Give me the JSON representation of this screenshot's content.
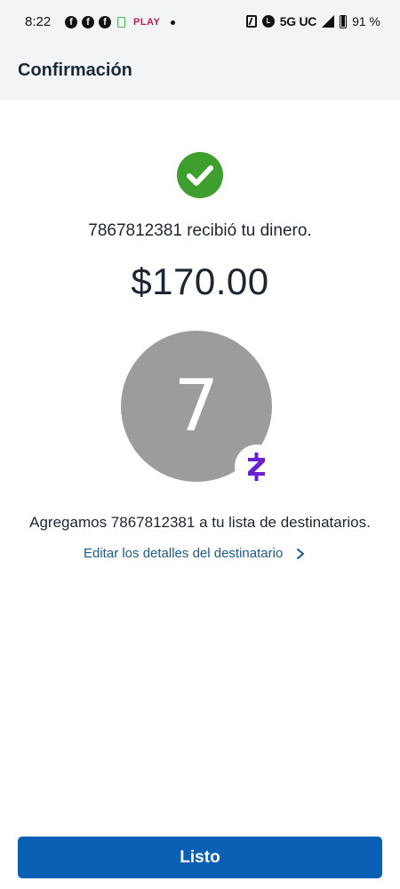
{
  "status_bar": {
    "time": "8:22",
    "left_icons": [
      "facebook-icon",
      "facebook-icon",
      "facebook-icon",
      "message-icon",
      "play-badge-icon",
      "dot-icon"
    ],
    "play_badge_top": "",
    "play_badge_text": "PLAY",
    "network": "5G UC",
    "battery_percent": 0.91,
    "battery_text": "91 %"
  },
  "app_bar": {
    "title": "Confirmación"
  },
  "main": {
    "status_icon": "check-circle-icon",
    "received_text": "7867812381 recibió tu dinero.",
    "amount": "$170.00",
    "recipient": {
      "initial": "7",
      "badge_icon": "zelle-logo-icon"
    },
    "added_text": "Agregamos 7867812381 a tu lista de destinatarios.",
    "edit_link_label": "Editar los detalles del destinatario",
    "edit_link_icon": "chevron-right-icon"
  },
  "footer": {
    "done_label": "Listo"
  },
  "colors": {
    "success": "#3f9f2e",
    "primary": "#0b5fb5",
    "link": "#1d5a87",
    "zelle": "#6d1ed4",
    "avatar": "#9c9c9c",
    "header_bg": "#f3f4f5"
  }
}
